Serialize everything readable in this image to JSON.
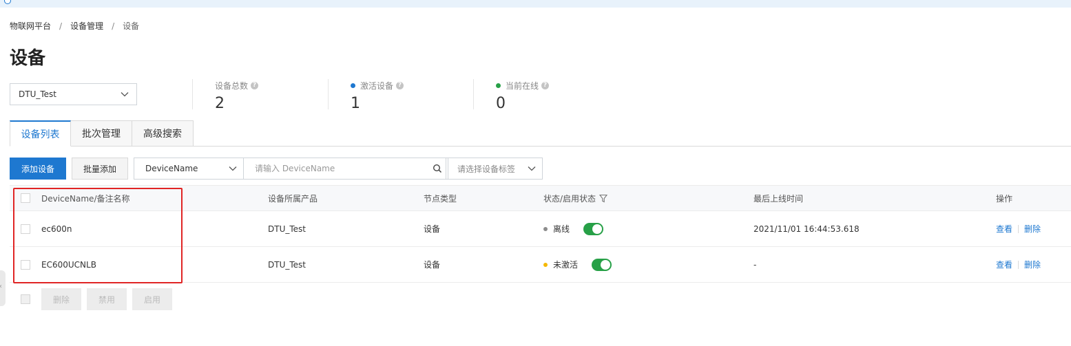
{
  "breadcrumb": [
    "物联网平台",
    "设备管理",
    "设备"
  ],
  "page_title": "设备",
  "product_select": {
    "value": "DTU_Test"
  },
  "stats": [
    {
      "label": "设备总数",
      "value": "2",
      "dot_color": null
    },
    {
      "label": "激活设备",
      "value": "1",
      "dot_color": "#1e78d0"
    },
    {
      "label": "当前在线",
      "value": "0",
      "dot_color": "#27a047"
    }
  ],
  "tabs": [
    {
      "label": "设备列表",
      "active": true
    },
    {
      "label": "批次管理",
      "active": false
    },
    {
      "label": "高级搜索",
      "active": false
    }
  ],
  "toolbar": {
    "add_device": "添加设备",
    "batch_add": "批量添加",
    "field_select": "DeviceName",
    "search_placeholder": "请输入 DeviceName",
    "tag_select_placeholder": "请选择设备标签"
  },
  "table": {
    "headers": {
      "name": "DeviceName/备注名称",
      "product": "设备所属产品",
      "node_type": "节点类型",
      "status": "状态/启用状态",
      "last_online": "最后上线时间",
      "actions": "操作"
    },
    "rows": [
      {
        "name": "ec600n",
        "product": "DTU_Test",
        "node_type": "设备",
        "status": "离线",
        "status_color": "#8c8c8c",
        "enabled": true,
        "last_online": "2021/11/01 16:44:53.618",
        "view": "查看",
        "delete": "删除"
      },
      {
        "name": "EC600UCNLB",
        "product": "DTU_Test",
        "node_type": "设备",
        "status": "未激活",
        "status_color": "#f5b800",
        "enabled": true,
        "last_online": "-",
        "view": "查看",
        "delete": "删除"
      }
    ]
  },
  "bulk_actions": {
    "delete": "删除",
    "disable": "禁用",
    "enable": "启用"
  },
  "colors": {
    "primary": "#1e78d0",
    "enabled_toggle": "#27a047",
    "highlight": "#e02424"
  }
}
